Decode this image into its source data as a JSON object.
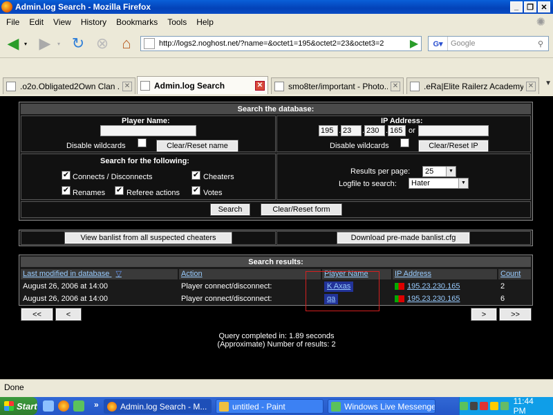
{
  "window": {
    "title": "Admin.log Search - Mozilla Firefox"
  },
  "menu": [
    "File",
    "Edit",
    "View",
    "History",
    "Bookmarks",
    "Tools",
    "Help"
  ],
  "url": "http://logs2.noghost.net/?name=&octet1=195&octet2=23&octet3=2",
  "search_engine": {
    "placeholder": "Google"
  },
  "tabs": [
    {
      "label": ".o2o.Obligated2Own Clan ...",
      "active": false
    },
    {
      "label": "Admin.log Search",
      "active": true
    },
    {
      "label": "smo8ter/important - Photo...",
      "active": false
    },
    {
      "label": ".eRa|Elite Railerz Academy...",
      "active": false
    }
  ],
  "search_form": {
    "header": "Search the database:",
    "player_name_label": "Player Name:",
    "player_name_value": "",
    "disable_wildcards_label": "Disable wildcards",
    "clear_name_button": "Clear/Reset name",
    "ip_label": "IP Address:",
    "octet1": "195",
    "octet2": "23",
    "octet3": "230",
    "octet4": "165",
    "or_label": "or",
    "ip_alt_value": "",
    "clear_ip_button": "Clear/Reset IP",
    "search_for_label": "Search for the following:",
    "options": {
      "connects": {
        "label": "Connects / Disconnects",
        "checked": true
      },
      "cheaters": {
        "label": "Cheaters",
        "checked": true
      },
      "renames": {
        "label": "Renames",
        "checked": true
      },
      "referee": {
        "label": "Referee actions",
        "checked": true
      },
      "votes": {
        "label": "Votes",
        "checked": true
      }
    },
    "results_per_page_label": "Results per page:",
    "results_per_page_value": "25",
    "logfile_label": "Logfile to search:",
    "logfile_value": "Hater",
    "search_button": "Search",
    "clear_form_button": "Clear/Reset form"
  },
  "banlist": {
    "view_button": "View banlist from all suspected cheaters",
    "download_button": "Download pre-made banlist.cfg"
  },
  "results": {
    "header": "Search results:",
    "columns": [
      "Last modified in database",
      "Action",
      "Player Name",
      "IP Address",
      "Count"
    ],
    "rows": [
      {
        "date": "August 26, 2006 at 14:00",
        "action": "Player connect/disconnect:",
        "player": "K Axas",
        "ip": "195.23.230.165",
        "count": "2"
      },
      {
        "date": "August 26, 2006 at 14:00",
        "action": "Player connect/disconnect:",
        "player": "qa",
        "ip": "195.23.230.165",
        "count": "6"
      }
    ],
    "nav": {
      "first": "<<",
      "prev": "<",
      "next": ">",
      "last": ">>"
    },
    "query_time": "Query completed in: 1.89 seconds",
    "result_count": "(Approximate) Number of results: 2"
  },
  "status": "Done",
  "taskbar": {
    "start": "Start",
    "tasks": [
      "Admin.log Search - M...",
      "untitled - Paint",
      "Windows Live Messenger"
    ],
    "clock": "11:44 PM"
  }
}
